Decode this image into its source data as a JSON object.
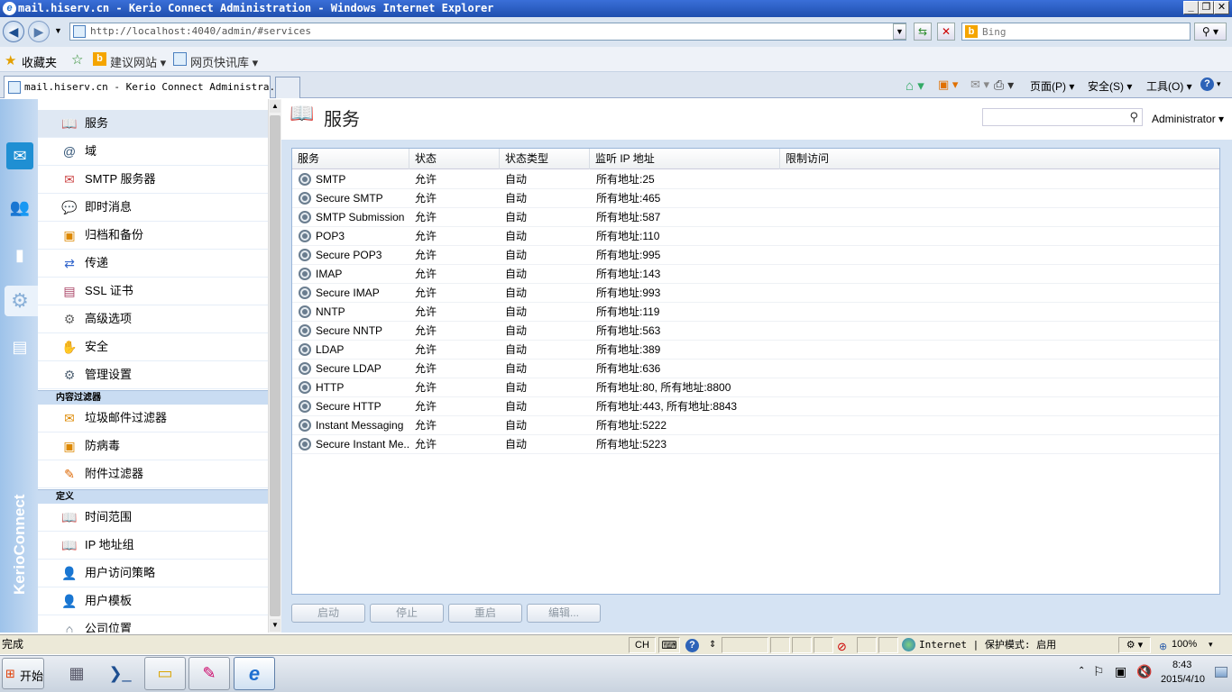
{
  "window": {
    "title": "mail.hiserv.cn - Kerio Connect Administration - Windows Internet Explorer",
    "min": "_",
    "max": "❐",
    "close": "✕"
  },
  "browser": {
    "address": "http://localhost:4040/admin/#services",
    "address_host": "localhost",
    "search_placeholder": "Bing",
    "favorites_label": "收藏夹",
    "fav_link1": "建议网站 ▾",
    "fav_link2": "网页快讯库 ▾",
    "tab_title": "mail.hiserv.cn - Kerio Connect Administra...",
    "menu_page": "页面(P) ▾",
    "menu_safety": "安全(S) ▾",
    "menu_tools": "工具(O) ▾"
  },
  "sidebar": {
    "items_top": [
      {
        "label": "服务"
      },
      {
        "label": "域"
      },
      {
        "label": "SMTP 服务器"
      },
      {
        "label": "即时消息"
      },
      {
        "label": "归档和备份"
      },
      {
        "label": "传递"
      },
      {
        "label": "SSL 证书"
      },
      {
        "label": "高级选项"
      },
      {
        "label": "安全"
      },
      {
        "label": "管理设置"
      }
    ],
    "section_filters": "内容过滤器",
    "items_filters": [
      {
        "label": "垃圾邮件过滤器"
      },
      {
        "label": "防病毒"
      },
      {
        "label": "附件过滤器"
      }
    ],
    "section_defs": "定义",
    "items_defs": [
      {
        "label": "时间范围"
      },
      {
        "label": "IP 地址组"
      },
      {
        "label": "用户访问策略"
      },
      {
        "label": "用户模板"
      },
      {
        "label": "公司位置"
      }
    ]
  },
  "brand": "KerioConnect",
  "page": {
    "title": "服务",
    "admin_menu": "Administrator ▾"
  },
  "grid": {
    "columns": [
      "服务",
      "状态",
      "状态类型",
      "监听 IP 地址",
      "限制访问"
    ],
    "rows": [
      [
        "SMTP",
        "允许",
        "自动",
        "所有地址:25",
        ""
      ],
      [
        "Secure SMTP",
        "允许",
        "自动",
        "所有地址:465",
        ""
      ],
      [
        "SMTP Submission",
        "允许",
        "自动",
        "所有地址:587",
        ""
      ],
      [
        "POP3",
        "允许",
        "自动",
        "所有地址:110",
        ""
      ],
      [
        "Secure POP3",
        "允许",
        "自动",
        "所有地址:995",
        ""
      ],
      [
        "IMAP",
        "允许",
        "自动",
        "所有地址:143",
        ""
      ],
      [
        "Secure IMAP",
        "允许",
        "自动",
        "所有地址:993",
        ""
      ],
      [
        "NNTP",
        "允许",
        "自动",
        "所有地址:119",
        ""
      ],
      [
        "Secure NNTP",
        "允许",
        "自动",
        "所有地址:563",
        ""
      ],
      [
        "LDAP",
        "允许",
        "自动",
        "所有地址:389",
        ""
      ],
      [
        "Secure LDAP",
        "允许",
        "自动",
        "所有地址:636",
        ""
      ],
      [
        "HTTP",
        "允许",
        "自动",
        "所有地址:80, 所有地址:8800",
        ""
      ],
      [
        "Secure HTTP",
        "允许",
        "自动",
        "所有地址:443, 所有地址:8843",
        ""
      ],
      [
        "Instant Messaging",
        "允许",
        "自动",
        "所有地址:5222",
        ""
      ],
      [
        "Secure Instant Me...",
        "允许",
        "自动",
        "所有地址:5223",
        ""
      ]
    ]
  },
  "actions": {
    "start": "启动",
    "stop": "停止",
    "restart": "重启",
    "edit": "编辑..."
  },
  "status": {
    "text": "完成",
    "ime": "CH",
    "zone": "Internet | 保护模式: 启用",
    "zoom": "100%"
  },
  "taskbar": {
    "start": "开始",
    "time": "8:43",
    "date": "2015/4/10"
  }
}
